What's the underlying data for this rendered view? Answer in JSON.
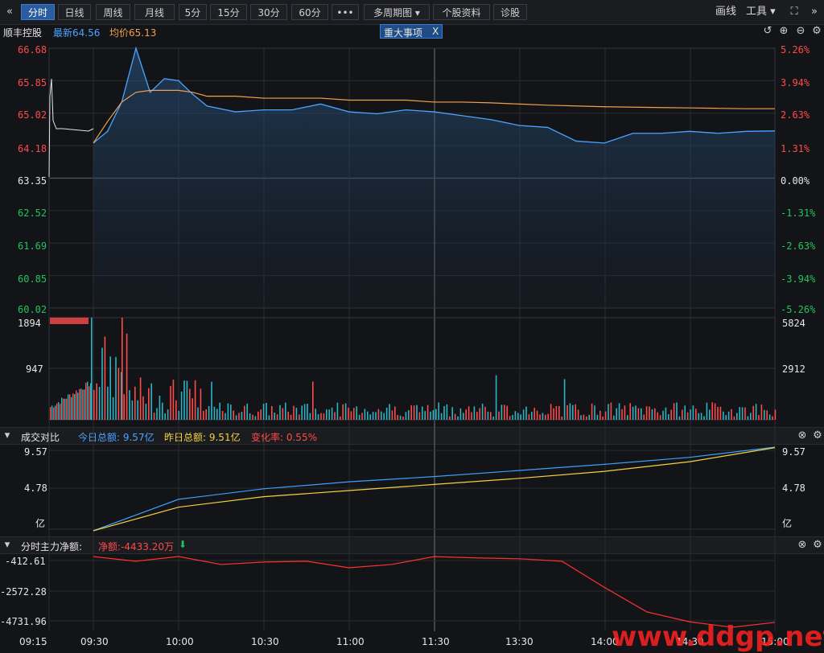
{
  "toolbar": {
    "collapse_icon": "double-left-chevron-icon",
    "buttons": [
      "分时",
      "日线",
      "周线",
      "月线",
      "5分",
      "15分",
      "30分",
      "60分",
      "•••",
      "多周期图 ▾",
      "个股资料",
      "诊股"
    ],
    "draw_label": "画线",
    "tools_label": "工具 ▾",
    "expand_icon": "fullscreen-icon",
    "more_icon": "more-right-chevron-icon"
  },
  "info": {
    "stock_name": "顺丰控股",
    "latest_label": "最新64.56",
    "avg_label": "均价65.13",
    "event_tag": "重大事项",
    "event_close": "X"
  },
  "price_axis": {
    "left": [
      "66.68",
      "65.85",
      "65.02",
      "64.18",
      "63.35",
      "62.52",
      "61.69",
      "60.85",
      "60.02"
    ],
    "right": [
      "5.26%",
      "3.94%",
      "2.63%",
      "1.31%",
      "0.00%",
      "-1.31%",
      "-2.63%",
      "-3.94%",
      "-5.26%"
    ]
  },
  "volume_axis": {
    "left": [
      "1894",
      "947"
    ],
    "right": [
      "5824",
      "2912"
    ]
  },
  "turnover_panel": {
    "title": "成交对比",
    "today_label": "今日总额: 9.57亿",
    "yesterday_label": "昨日总额: 9.51亿",
    "change_label": "变化率: 0.55%",
    "axis_left": [
      "9.57",
      "4.78",
      "亿"
    ],
    "axis_right": [
      "9.57",
      "4.78",
      "亿"
    ]
  },
  "netflow_panel": {
    "title": "分时主力净额:",
    "net_label": "净额:-4433.20万",
    "axis_left": [
      "-412.61",
      "-2572.28",
      "-4731.96"
    ]
  },
  "time_axis": [
    "09:15",
    "09:30",
    "10:00",
    "10:30",
    "11:00",
    "11:30",
    "13:30",
    "14:00",
    "14:30",
    "15:00"
  ],
  "watermark": "www.ddgp.net",
  "colors": {
    "price_line": "#4aa3ff",
    "avg_line": "#f0a24a",
    "up": "#ff4a4a",
    "down": "#22c45e",
    "today": "#3aa0ff",
    "yesterday": "#f5d142",
    "netflow": "#ff3030"
  },
  "chart_data": [
    {
      "type": "line",
      "title": "分时",
      "x": [
        "09:30",
        "09:35",
        "09:40",
        "09:45",
        "09:50",
        "09:55",
        "10:00",
        "10:05",
        "10:10",
        "10:20",
        "10:30",
        "10:40",
        "10:50",
        "11:00",
        "11:10",
        "11:20",
        "11:30",
        "13:10",
        "13:20",
        "13:30",
        "13:40",
        "13:50",
        "14:00",
        "14:10",
        "14:20",
        "14:30",
        "14:40",
        "14:50",
        "15:00"
      ],
      "series": [
        {
          "name": "最新",
          "values": [
            64.25,
            64.55,
            65.3,
            66.68,
            65.55,
            65.9,
            65.85,
            65.5,
            65.2,
            65.05,
            65.1,
            65.1,
            65.25,
            65.05,
            65.0,
            65.1,
            65.05,
            64.95,
            64.85,
            64.7,
            64.65,
            64.3,
            64.25,
            64.5,
            64.5,
            64.55,
            64.5,
            64.55,
            64.56
          ]
        },
        {
          "name": "均价",
          "values": [
            64.25,
            64.8,
            65.3,
            65.55,
            65.6,
            65.6,
            65.6,
            65.55,
            65.45,
            65.45,
            65.4,
            65.4,
            65.4,
            65.35,
            65.35,
            65.35,
            65.3,
            65.3,
            65.28,
            65.25,
            65.22,
            65.2,
            65.18,
            65.17,
            65.16,
            65.15,
            65.14,
            65.13,
            65.13
          ]
        }
      ],
      "ylim": [
        60.02,
        66.68
      ]
    },
    {
      "type": "bar",
      "title": "成交量",
      "ylim": [
        0,
        1894
      ]
    },
    {
      "type": "line",
      "title": "成交对比",
      "x": [
        "09:30",
        "10:00",
        "10:30",
        "11:00",
        "11:30",
        "13:30",
        "14:00",
        "14:30",
        "15:00"
      ],
      "series": [
        {
          "name": "今日总额",
          "values": [
            0,
            3.6,
            4.8,
            5.6,
            6.2,
            6.9,
            7.6,
            8.4,
            9.57
          ]
        },
        {
          "name": "昨日总额",
          "values": [
            0,
            2.7,
            3.9,
            4.6,
            5.3,
            6.0,
            6.8,
            7.9,
            9.51
          ]
        }
      ],
      "ylim": [
        0,
        9.57
      ]
    },
    {
      "type": "line",
      "title": "分时主力净额",
      "x": [
        "09:30",
        "09:45",
        "10:00",
        "10:15",
        "10:30",
        "10:45",
        "11:00",
        "11:15",
        "11:30",
        "13:15",
        "13:30",
        "13:45",
        "14:00",
        "14:15",
        "14:30",
        "14:45",
        "15:00"
      ],
      "series": [
        {
          "name": "净额",
          "values": [
            -420,
            -700,
            -412,
            -900,
            -750,
            -700,
            -1100,
            -900,
            -420,
            -500,
            -550,
            -700,
            -2300,
            -3800,
            -4400,
            -4731,
            -4433
          ]
        }
      ],
      "ylim": [
        -4731.96,
        -412.61
      ]
    }
  ]
}
